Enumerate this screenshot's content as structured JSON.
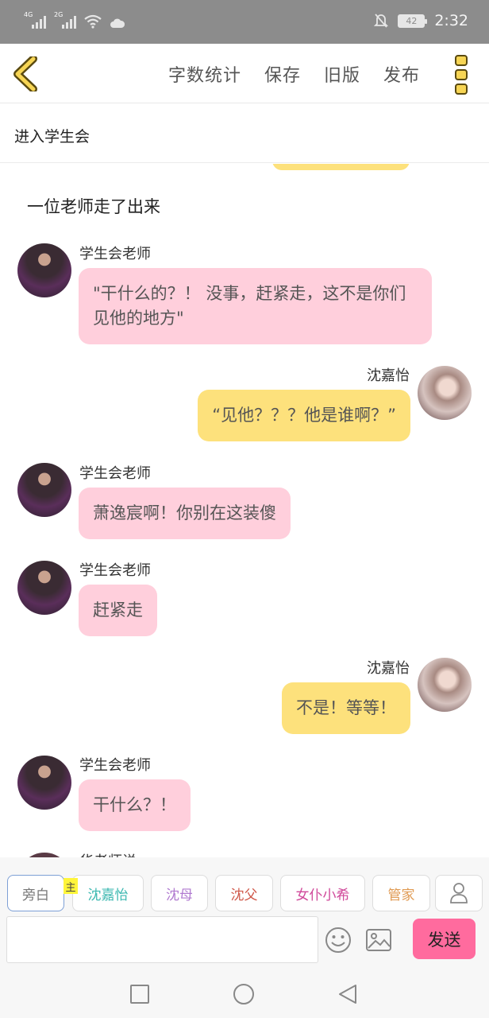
{
  "status_bar": {
    "net1": "4G",
    "net2": "2G",
    "battery": "42",
    "time": "2:32"
  },
  "toolbar": {
    "word_count": "字数统计",
    "save": "保存",
    "old_version": "旧版",
    "publish": "发布"
  },
  "chapter": {
    "title": "进入学生会"
  },
  "chat": {
    "narration": "一位老师走了出来",
    "messages": [
      {
        "side": "left",
        "name": "学生会老师",
        "text": "\"干什么的？！ 没事，赶紧走，这不是你们见他的地方\""
      },
      {
        "side": "right",
        "name": "沈嘉怡",
        "text": "“见他？？？他是谁啊？”"
      },
      {
        "side": "left",
        "name": "学生会老师",
        "text": "萧逸宸啊！你别在这装傻"
      },
      {
        "side": "left",
        "name": "学生会老师",
        "text": "赶紧走"
      },
      {
        "side": "right",
        "name": "沈嘉怡",
        "text": "不是！等等！"
      },
      {
        "side": "left",
        "name": "学生会老师",
        "text": "干什么？！"
      }
    ],
    "cut_name": "华老师说"
  },
  "compose": {
    "roles": [
      {
        "label": "旁白",
        "color": "#777777"
      },
      {
        "label": "沈嘉怡",
        "color": "#3bb8b0"
      },
      {
        "label": "沈母",
        "color": "#b07ad0"
      },
      {
        "label": "沈父",
        "color": "#d0584a"
      },
      {
        "label": "女仆小希",
        "color": "#d0489a"
      },
      {
        "label": "管家",
        "color": "#e09a52"
      }
    ],
    "main_tag": "主",
    "send": "发送",
    "input_value": ""
  },
  "colors": {
    "pink_bubble": "#ffcfdc",
    "yellow_bubble": "#fde17c",
    "send_button": "#ff6b9e"
  }
}
